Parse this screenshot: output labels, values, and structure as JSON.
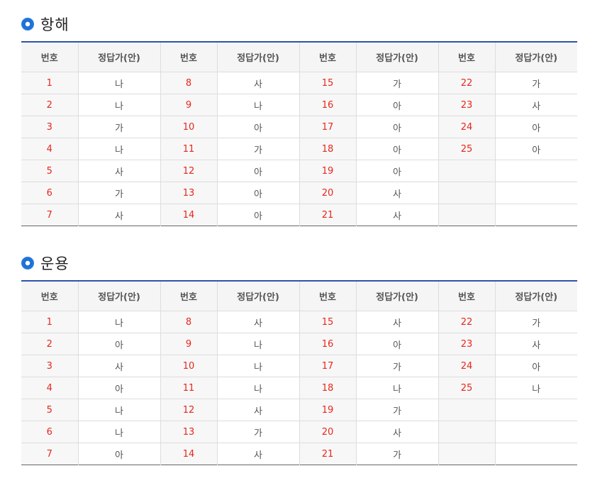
{
  "colors": {
    "accent": "#2c54a8",
    "number": "#e8261b",
    "header_bg": "#f5f5f5"
  },
  "sections": [
    {
      "title": "항해",
      "headers": [
        "번호",
        "정답가(안)",
        "번호",
        "정답가(안)",
        "번호",
        "정답가(안)",
        "번호",
        "정답가(안)"
      ],
      "rows": [
        [
          "1",
          "나",
          "8",
          "사",
          "15",
          "가",
          "22",
          "가"
        ],
        [
          "2",
          "나",
          "9",
          "나",
          "16",
          "아",
          "23",
          "사"
        ],
        [
          "3",
          "가",
          "10",
          "아",
          "17",
          "아",
          "24",
          "아"
        ],
        [
          "4",
          "나",
          "11",
          "가",
          "18",
          "아",
          "25",
          "아"
        ],
        [
          "5",
          "사",
          "12",
          "아",
          "19",
          "아",
          "",
          ""
        ],
        [
          "6",
          "가",
          "13",
          "아",
          "20",
          "사",
          "",
          ""
        ],
        [
          "7",
          "사",
          "14",
          "아",
          "21",
          "사",
          "",
          ""
        ]
      ]
    },
    {
      "title": "운용",
      "headers": [
        "번호",
        "정답가(안)",
        "번호",
        "정답가(안)",
        "번호",
        "정답가(안)",
        "번호",
        "정답가(안)"
      ],
      "rows": [
        [
          "1",
          "나",
          "8",
          "사",
          "15",
          "사",
          "22",
          "가"
        ],
        [
          "2",
          "아",
          "9",
          "나",
          "16",
          "아",
          "23",
          "사"
        ],
        [
          "3",
          "사",
          "10",
          "나",
          "17",
          "가",
          "24",
          "아"
        ],
        [
          "4",
          "아",
          "11",
          "나",
          "18",
          "나",
          "25",
          "나"
        ],
        [
          "5",
          "나",
          "12",
          "사",
          "19",
          "가",
          "",
          ""
        ],
        [
          "6",
          "나",
          "13",
          "가",
          "20",
          "사",
          "",
          ""
        ],
        [
          "7",
          "아",
          "14",
          "사",
          "21",
          "가",
          "",
          ""
        ]
      ]
    }
  ]
}
